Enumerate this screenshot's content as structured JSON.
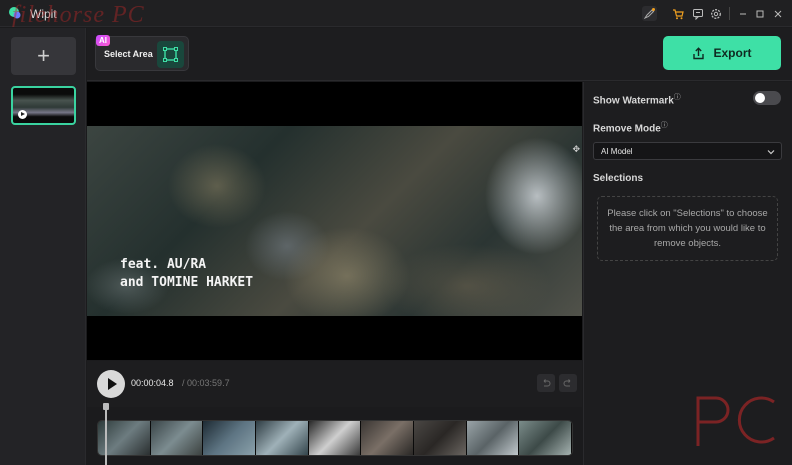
{
  "app": {
    "title": "Wipit"
  },
  "overlay": {
    "site_watermark": "filehorse PC"
  },
  "titlebar": {
    "icons": [
      "edit-badge-icon",
      "cart-icon",
      "feedback-icon",
      "settings-icon",
      "minimize-icon",
      "maximize-icon",
      "close-icon"
    ],
    "cart_color": "#f0a020"
  },
  "sidebar": {
    "add_label": "+",
    "clip_count": 1
  },
  "toolbar": {
    "ai_badge": "AI",
    "select_area_label": "Select Area",
    "export_label": "Export",
    "accent_color": "#3ee0a6"
  },
  "preview": {
    "caption_line1": "feat. AU/RA",
    "caption_line2": "and TOMINE HARKET"
  },
  "playback": {
    "current_time": "00:00:04.8",
    "separator": "/",
    "total_time": "00:03:59.7"
  },
  "panel": {
    "show_watermark_label": "Show Watermark",
    "show_watermark_enabled": false,
    "remove_mode_label": "Remove Mode",
    "remove_mode_value": "AI Model",
    "selections_label": "Selections",
    "selections_hint": "Please click on \"Selections\" to choose the area from which you would like to remove objects."
  }
}
